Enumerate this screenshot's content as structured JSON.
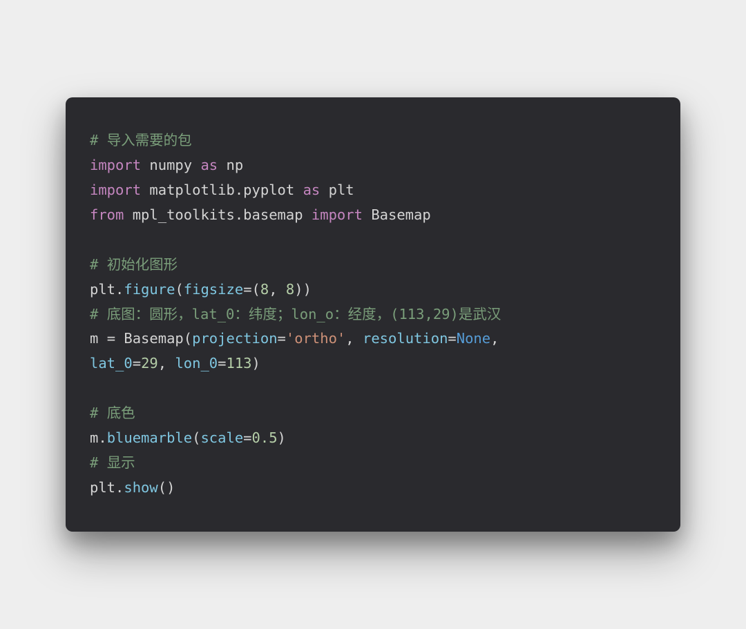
{
  "code": {
    "line1": {
      "hash": "# ",
      "comment": "导入需要的包"
    },
    "line2": {
      "kw1": "import",
      "sp": " ",
      "id1": "numpy",
      "sp2": " ",
      "kw2": "as",
      "sp3": " ",
      "id2": "np"
    },
    "line3": {
      "kw1": "import",
      "sp": " ",
      "id1": "matplotlib.pyplot",
      "sp2": " ",
      "kw2": "as",
      "sp3": " ",
      "id2": "plt"
    },
    "line4": {
      "kw1": "from",
      "sp": " ",
      "id1": "mpl_toolkits.basemap",
      "sp2": " ",
      "kw2": "import",
      "sp3": " ",
      "id2": "Basemap"
    },
    "line6": {
      "hash": "# ",
      "comment": "初始化图形"
    },
    "line7": {
      "obj": "plt",
      "dot": ".",
      "fn": "figure",
      "lp": "(",
      "param": "figsize",
      "eq": "=",
      "tup": "(",
      "n1": "8",
      "comma": ", ",
      "n2": "8",
      "tup2": ")",
      "rp": ")"
    },
    "line8": {
      "hash": "# ",
      "comment": "底图：圆形，lat_0：纬度；lon_o：经度，(113,29)是武汉"
    },
    "line9a": {
      "var": "m",
      "sp": " ",
      "eq": "=",
      "sp2": " ",
      "cls": "Basemap",
      "lp": "(",
      "p1": "projection",
      "eq1": "=",
      "s1": "'ortho'",
      "c1": ", ",
      "p2": "resolution",
      "eq2": "=",
      "none": "None",
      "c2": ","
    },
    "line9b": {
      "p3": "lat_0",
      "eq3": "=",
      "n3": "29",
      "c3": ", ",
      "p4": "lon_0",
      "eq4": "=",
      "n4": "113",
      "rp": ")"
    },
    "line11": {
      "hash": "# ",
      "comment": "底色"
    },
    "line12": {
      "obj": "m",
      "dot": ".",
      "fn": "bluemarble",
      "lp": "(",
      "param": "scale",
      "eq": "=",
      "n": "0.5",
      "rp": ")"
    },
    "line13": {
      "hash": "# ",
      "comment": "显示"
    },
    "line14": {
      "obj": "plt",
      "dot": ".",
      "fn": "show",
      "lp": "(",
      "rp": ")"
    }
  }
}
